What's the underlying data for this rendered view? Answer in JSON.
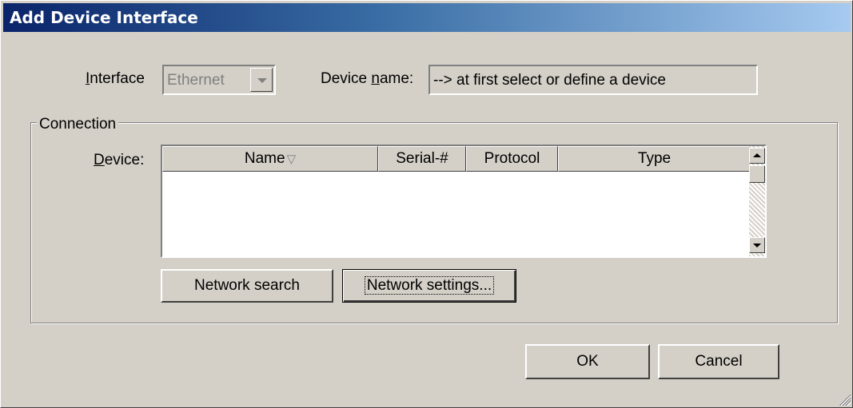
{
  "window": {
    "title": "Add Device Interface"
  },
  "interface": {
    "label_pre": "",
    "label_hotkey": "I",
    "label_post": "nterface",
    "value": "Ethernet"
  },
  "device_name": {
    "label_pre": "Device ",
    "label_hotkey": "n",
    "label_post": "ame:",
    "value": "--> at first select or define a device"
  },
  "connection": {
    "group_label": "Connection",
    "device_label_hotkey": "D",
    "device_label_post": "evice:",
    "columns": [
      {
        "label": "Name",
        "sort_glyph": "▽"
      },
      {
        "label": "Serial-#"
      },
      {
        "label": "Protocol"
      },
      {
        "label": "Type"
      }
    ],
    "rows": []
  },
  "buttons": {
    "network_search": "Network search",
    "network_settings_pre": "Network settin",
    "network_settings_hotkey": "g",
    "network_settings_post": "s...",
    "ok": "OK",
    "cancel": "Cancel"
  },
  "icons": [
    "chevron-down-icon",
    "scroll-up-icon",
    "scroll-down-icon",
    "sort-descending-icon",
    "resize-grip-icon"
  ]
}
